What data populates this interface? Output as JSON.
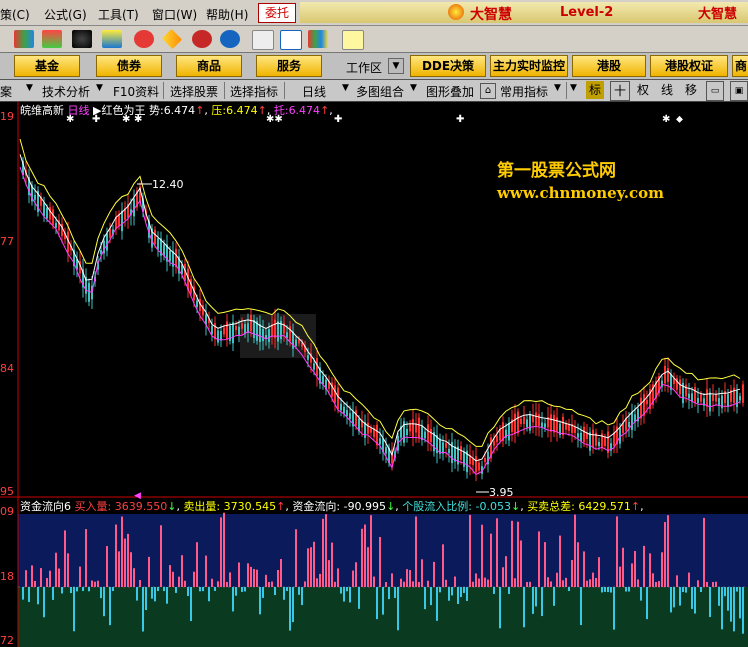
{
  "menubar": {
    "items": [
      "策(C)",
      "公式(G)",
      "工具(T)",
      "窗口(W)",
      "帮助(H)"
    ],
    "weituo": "委托",
    "brand": "大智慧",
    "level": "Level-2",
    "brand_right": "大智慧"
  },
  "buttons": [
    "基金",
    "债券",
    "商品",
    "服务"
  ],
  "workspace_label": "工作区",
  "top_right_buttons": [
    "DDE决策",
    "主力实时监控",
    "港股",
    "港股权证",
    "商"
  ],
  "funcrow": {
    "left": "案",
    "items": [
      "技术分析",
      "F10资料",
      "选择股票",
      "选择指标",
      "日线",
      "多图组合",
      "图形叠加",
      "常用指标"
    ],
    "right_buttons": [
      "标",
      "十",
      "权",
      "线",
      "移"
    ]
  },
  "info_top": {
    "name": "皖维高新",
    "period": "日线",
    "formula": "红色为王",
    "shi_label": "势:",
    "shi_value": "6.474",
    "ya_label": "压:",
    "ya_value": "6.474",
    "tuo_label": "托:",
    "tuo_value": "6.474"
  },
  "info_bottom": {
    "name": "资金流向6",
    "buy_label": "买入量:",
    "buy_value": "3639.550",
    "sell_label": "卖出量:",
    "sell_value": "3730.545",
    "flow_label": "资金流向:",
    "flow_value": "-90.995",
    "ratio_label": "个股流入比例:",
    "ratio_value": "-0.053",
    "diff_label": "买卖总差:",
    "diff_value": "6429.571"
  },
  "watermark": {
    "line1": "第一股票公式网",
    "line2": "www.chnmoney.com"
  },
  "price_labels": {
    "high": "12.40",
    "low": "3.95"
  },
  "y_axis_main": [
    "19",
    "77",
    "84",
    "95"
  ],
  "y_axis_sub": [
    "09",
    "18",
    "72"
  ],
  "colors": {
    "up": "#ff3030",
    "down": "#40c0c0",
    "line_yellow": "#ffff40",
    "line_white": "#ffffff",
    "line_magenta": "#ff40ff"
  }
}
